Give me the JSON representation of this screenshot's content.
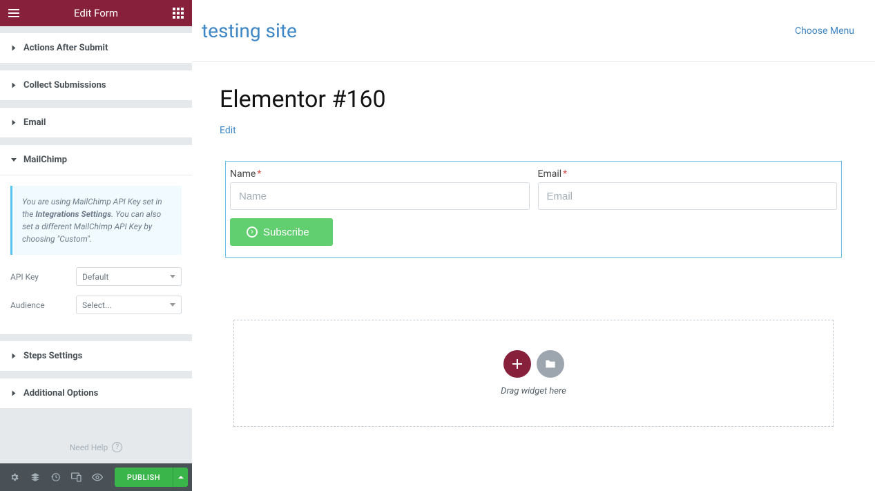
{
  "sidebar": {
    "title": "Edit Form",
    "sections": {
      "actions": "Actions After Submit",
      "collect": "Collect Submissions",
      "email": "Email",
      "mailchimp": "MailChimp",
      "steps": "Steps Settings",
      "additional": "Additional Options"
    },
    "mailchimp": {
      "info_pre": "You are using MailChimp API Key set in the ",
      "info_bold": "Integrations Settings",
      "info_post": ". You can also set a different MailChimp API Key by choosing \"Custom\".",
      "apikey_label": "API Key",
      "apikey_value": "Default",
      "audience_label": "Audience",
      "audience_value": "Select..."
    },
    "need_help": "Need Help",
    "publish": "PUBLISH"
  },
  "canvas": {
    "site_title": "testing site",
    "choose_menu": "Choose Menu",
    "page_title": "Elementor #160",
    "edit": "Edit",
    "form": {
      "name_label": "Name",
      "name_placeholder": "Name",
      "email_label": "Email",
      "email_placeholder": "Email",
      "subscribe": "Subscribe"
    },
    "dropzone": "Drag widget here"
  }
}
